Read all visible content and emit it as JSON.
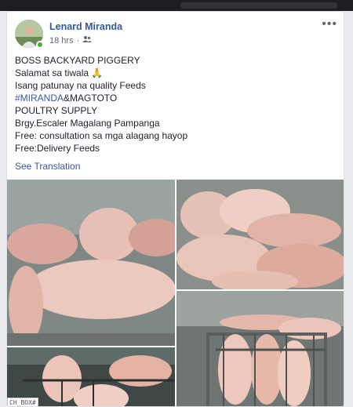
{
  "post": {
    "author": "Lenard Miranda",
    "time": "18 hrs",
    "privacy_icon": "friends-icon",
    "more_label": "•••",
    "lines": [
      "BOSS BACKYARD PIGGERY",
      "Salamat sa tiwala 🙏",
      "Isang patunay na quality Feeds",
      "#MIRANDA&MAGTOTO",
      "POULTRY SUPPLY",
      "Brgy.Escaler Magalang Pampanga",
      "Free: consultation sa mga alagang hayop",
      "Free:Delivery Feeds"
    ],
    "hashtag_part": "#MIRANDA",
    "hashtag_rest": "&MAGTOTO",
    "see_translation": "See Translation"
  },
  "watermark": "CH_BOX#",
  "colors": {
    "link": "#385898",
    "online": "#42b72a"
  }
}
